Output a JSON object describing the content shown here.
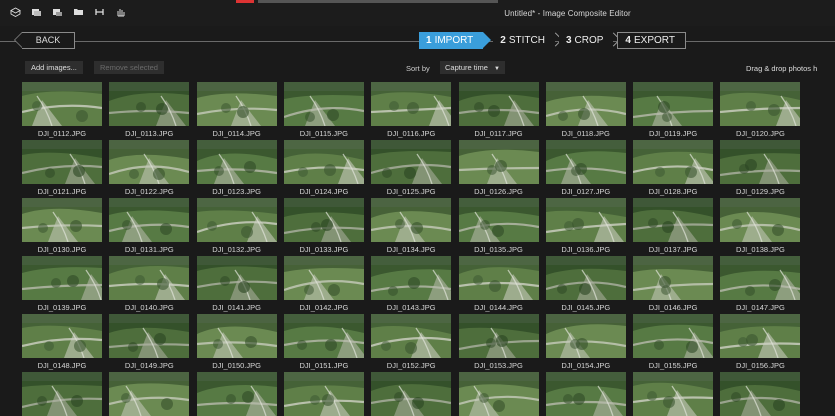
{
  "window": {
    "title": "Untitled* - Image Composite Editor",
    "quick_access_icons": [
      "new-project-icon",
      "open-icon",
      "save-icon",
      "folder-icon",
      "split-icon",
      "touch-mode-icon"
    ]
  },
  "nav": {
    "back_label": "BACK",
    "steps": [
      {
        "num": "1",
        "label": "IMPORT",
        "active": true
      },
      {
        "num": "2",
        "label": "STITCH",
        "active": false
      },
      {
        "num": "3",
        "label": "CROP",
        "active": false
      },
      {
        "num": "4",
        "label": "EXPORT",
        "active": false
      }
    ]
  },
  "toolbar": {
    "add_images_label": "Add images...",
    "remove_selected_label": "Remove selected",
    "sort_by_label": "Sort by",
    "sort_value": "Capture time",
    "drag_drop_hint": "Drag & drop photos h"
  },
  "images": [
    "DJI_0112.JPG",
    "DJI_0113.JPG",
    "DJI_0114.JPG",
    "DJI_0115.JPG",
    "DJI_0116.JPG",
    "DJI_0117.JPG",
    "DJI_0118.JPG",
    "DJI_0119.JPG",
    "DJI_0120.JPG",
    "DJI_0121.JPG",
    "DJI_0122.JPG",
    "DJI_0123.JPG",
    "DJI_0124.JPG",
    "DJI_0125.JPG",
    "DJI_0126.JPG",
    "DJI_0127.JPG",
    "DJI_0128.JPG",
    "DJI_0129.JPG",
    "DJI_0130.JPG",
    "DJI_0131.JPG",
    "DJI_0132.JPG",
    "DJI_0133.JPG",
    "DJI_0134.JPG",
    "DJI_0135.JPG",
    "DJI_0136.JPG",
    "DJI_0137.JPG",
    "DJI_0138.JPG",
    "DJI_0139.JPG",
    "DJI_0140.JPG",
    "DJI_0141.JPG",
    "DJI_0142.JPG",
    "DJI_0143.JPG",
    "DJI_0144.JPG",
    "DJI_0145.JPG",
    "DJI_0146.JPG",
    "DJI_0147.JPG",
    "DJI_0148.JPG",
    "DJI_0149.JPG",
    "DJI_0150.JPG",
    "DJI_0151.JPG",
    "DJI_0152.JPG",
    "DJI_0153.JPG",
    "DJI_0154.JPG",
    "DJI_0155.JPG",
    "DJI_0156.JPG",
    "",
    "",
    "",
    "",
    "",
    "",
    "",
    "",
    ""
  ],
  "colors": {
    "accent": "#3a9edb",
    "background": "#1a1a1a"
  }
}
